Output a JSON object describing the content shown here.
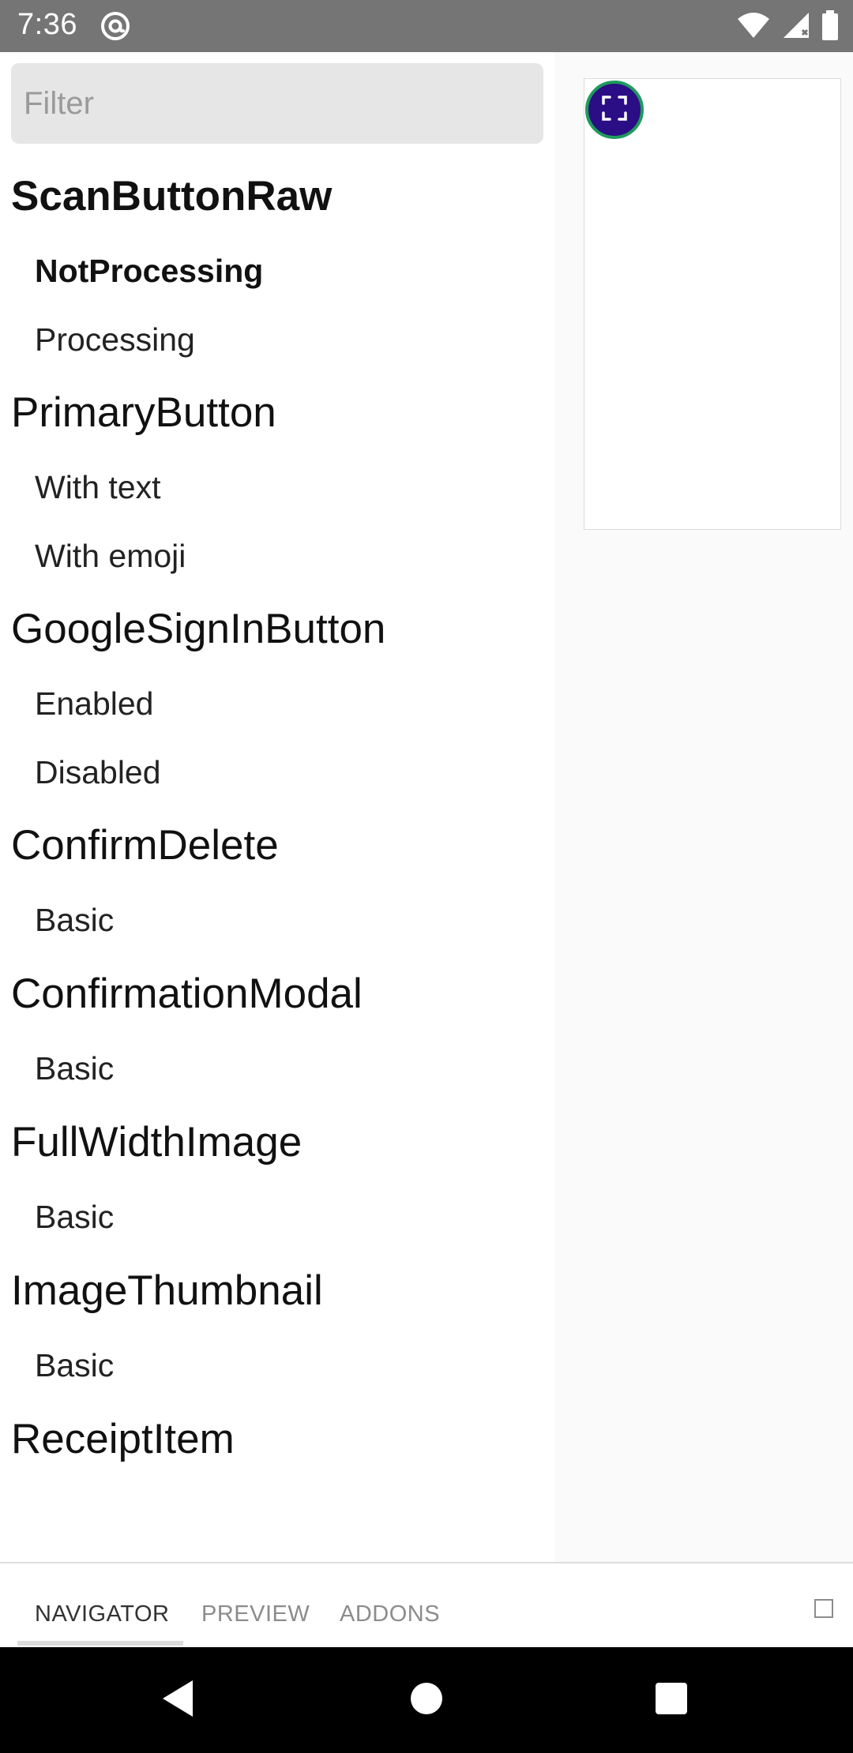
{
  "status_bar": {
    "time": "7:36"
  },
  "filter": {
    "placeholder": "Filter",
    "value": ""
  },
  "navigator": {
    "groups": [
      {
        "title": "ScanButtonRaw",
        "stories": [
          "NotProcessing",
          "Processing"
        ]
      },
      {
        "title": "PrimaryButton",
        "stories": [
          "With text",
          "With emoji"
        ]
      },
      {
        "title": "GoogleSignInButton",
        "stories": [
          "Enabled",
          "Disabled"
        ]
      },
      {
        "title": "ConfirmDelete",
        "stories": [
          "Basic"
        ]
      },
      {
        "title": "ConfirmationModal",
        "stories": [
          "Basic"
        ]
      },
      {
        "title": "FullWidthImage",
        "stories": [
          "Basic"
        ]
      },
      {
        "title": "ImageThumbnail",
        "stories": [
          "Basic"
        ]
      },
      {
        "title": "ReceiptItem",
        "stories": []
      }
    ],
    "selected_group": "ScanButtonRaw",
    "selected_story": "NotProcessing"
  },
  "preview": {
    "scan_button_colors": {
      "fill": "#2b0d85",
      "border": "#1f9a5d"
    }
  },
  "tabs": [
    {
      "label": "NAVIGATOR",
      "active": true
    },
    {
      "label": "PREVIEW",
      "active": false
    },
    {
      "label": "ADDONS",
      "active": false
    }
  ],
  "icons": {
    "status": [
      "at-sign-icon",
      "wifi-icon",
      "signal-icon",
      "battery-icon"
    ],
    "preview": "scan-frame-icon",
    "navigation": [
      "back-icon",
      "home-icon",
      "recents-icon"
    ]
  }
}
